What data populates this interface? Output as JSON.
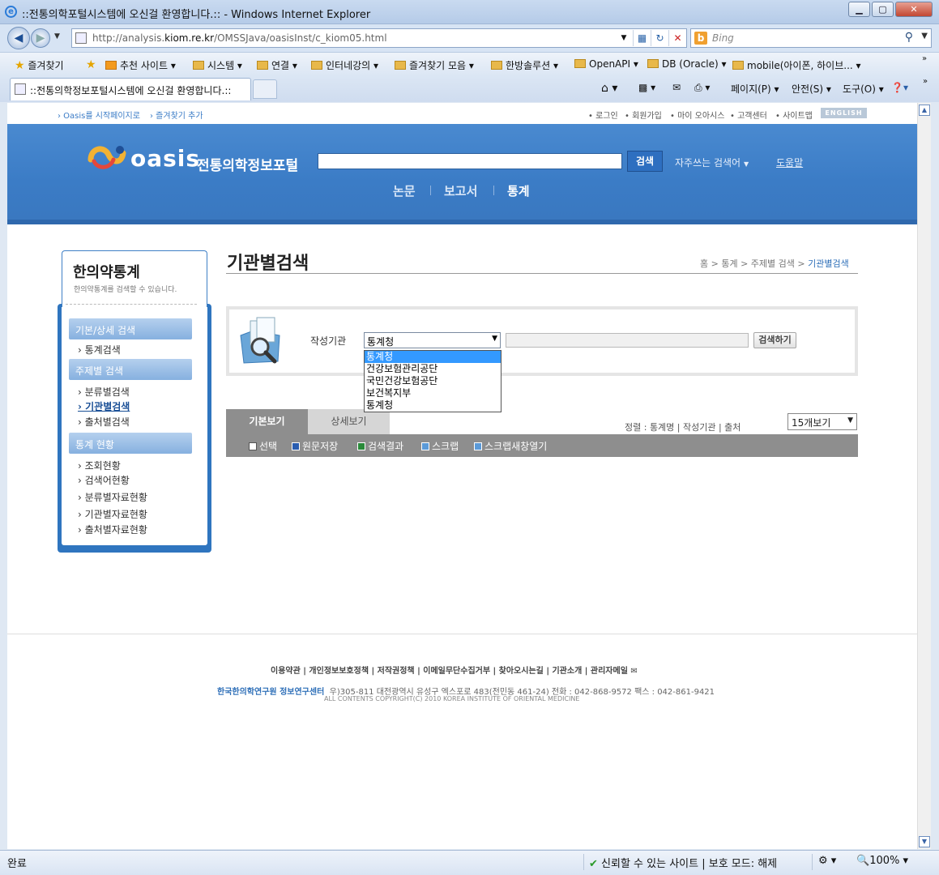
{
  "window": {
    "title": "::전통의학포털시스템에 오신걸 환영합니다.:: - Windows Internet Explorer"
  },
  "address": {
    "url_prefix": "http://analysis.",
    "url_domain": "kiom.re.kr",
    "url_path": "/OMSSJava/oasisInst/c_kiom05.html",
    "search_placeholder": "Bing"
  },
  "favorites": {
    "label": "즐겨찾기",
    "items": [
      "추천 사이트 ▾",
      "시스템 ▾",
      "연결 ▾",
      "인터네강의 ▾",
      "즐겨찾기 모음 ▾",
      "한방솔루션 ▾",
      "OpenAPI ▾",
      "DB (Oracle) ▾",
      "mobile(아이폰, 하이브... ▾"
    ]
  },
  "tab": {
    "title": "::전통의학정보포털시스템에 오신걸 환영합니다.::"
  },
  "commandbar": {
    "page": "페이지(P) ▾",
    "safety": "안전(S) ▾",
    "tools": "도구(O) ▾"
  },
  "site": {
    "toplinks_left": [
      "› Oasis를 시작페이지로",
      "› 즐겨찾기 추가"
    ],
    "toplinks_right": [
      "• 로그인",
      "• 회원가입",
      "• 마이 오아시스",
      "• 고객센터",
      "• 사이트맵"
    ],
    "english": "ENGLISH",
    "logo": "oasis",
    "logo_sub": "전통의학정보포털",
    "search_button": "검색",
    "frequent": "자주쓰는 검색어",
    "help": "도움말",
    "gnb": [
      "논문",
      "보고서",
      "통계"
    ]
  },
  "left": {
    "title": "한의약통계",
    "desc": "한의약통계를 검색할 수 있습니다.",
    "cats": [
      "기본/상세 검색",
      "주제별 검색",
      "통계 현황"
    ],
    "items_basic": [
      "› 통계검색"
    ],
    "items_topic": [
      "› 분류별검색",
      "› 기관별검색",
      "› 출처별검색"
    ],
    "items_status": [
      "› 조회현황",
      "› 검색어현황",
      "› 분류별자료현황",
      "› 기관별자료현황",
      "› 출처별자료현황"
    ]
  },
  "content": {
    "title": "기관별검색",
    "breadcrumb": "홈 > 통계 > 주제별 검색 > ",
    "breadcrumb_current": "기관별검색",
    "author_label": "작성기관",
    "selected": "통계청",
    "search_button": "검색하기",
    "options": [
      "통계청",
      "건강보험관리공단",
      "국민건강보험공단",
      "보건복지부",
      "통계청"
    ],
    "tabs": [
      "기본보기",
      "상세보기"
    ],
    "sort": "정렬 : 통계명 | 작성기관 | 출처",
    "per_page": "15개보기",
    "toolbar": [
      "선택",
      "원문저장",
      "검색결과",
      "스크랩",
      "스크랩새창열기"
    ]
  },
  "footer": {
    "links": "이용약관 | 개인정보보호정책 | 저작권정책 | 이메일무단수집거부 | 찾아오시는길 | 기관소개 | 관리자메일 ✉",
    "org": "한국한의학연구원 정보연구센터",
    "address": "우)305-811 대전광역시 유성구 엑스포로 483(전민동 461-24) 전화 : 042-868-9572 팩스 : 042-861-9421",
    "copyright": "ALL CONTENTS COPYRIGHT(C) 2010 KOREA INSTITUTE OF ORIENTAL MEDICINE"
  },
  "statusbar": {
    "left": "완료",
    "trust": "신뢰할 수 있는 사이트 | 보호 모드: 해제",
    "zoom": "100%"
  }
}
